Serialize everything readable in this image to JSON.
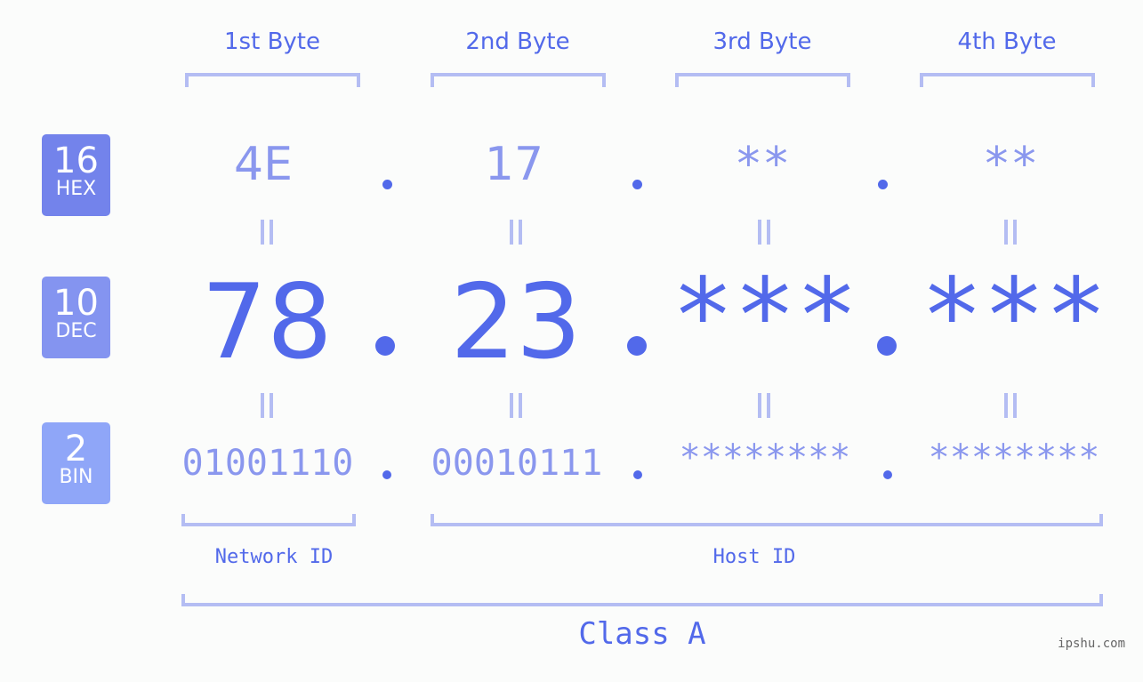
{
  "colors": {
    "accent": "#5269ea",
    "light_text": "#8a97ee",
    "bracket": "#b4bdf3",
    "hex_badge": "#7383eb",
    "dec_badge": "#8494f0",
    "bin_badge": "#8fa6f8",
    "background": "#fbfcfb"
  },
  "byte_headers": [
    "1st Byte",
    "2nd Byte",
    "3rd Byte",
    "4th Byte"
  ],
  "badges": [
    {
      "number": "16",
      "label": "HEX"
    },
    {
      "number": "10",
      "label": "DEC"
    },
    {
      "number": "2",
      "label": "BIN"
    }
  ],
  "rows": {
    "hex": [
      "4E",
      "17",
      "**",
      "**"
    ],
    "dec": [
      "78",
      "23",
      "***",
      "***"
    ],
    "bin": [
      "01001110",
      "00010111",
      "********",
      "********"
    ]
  },
  "separator": ".",
  "sections": {
    "network_id": "Network ID",
    "host_id": "Host ID",
    "class": "Class A"
  },
  "watermark": "ipshu.com"
}
